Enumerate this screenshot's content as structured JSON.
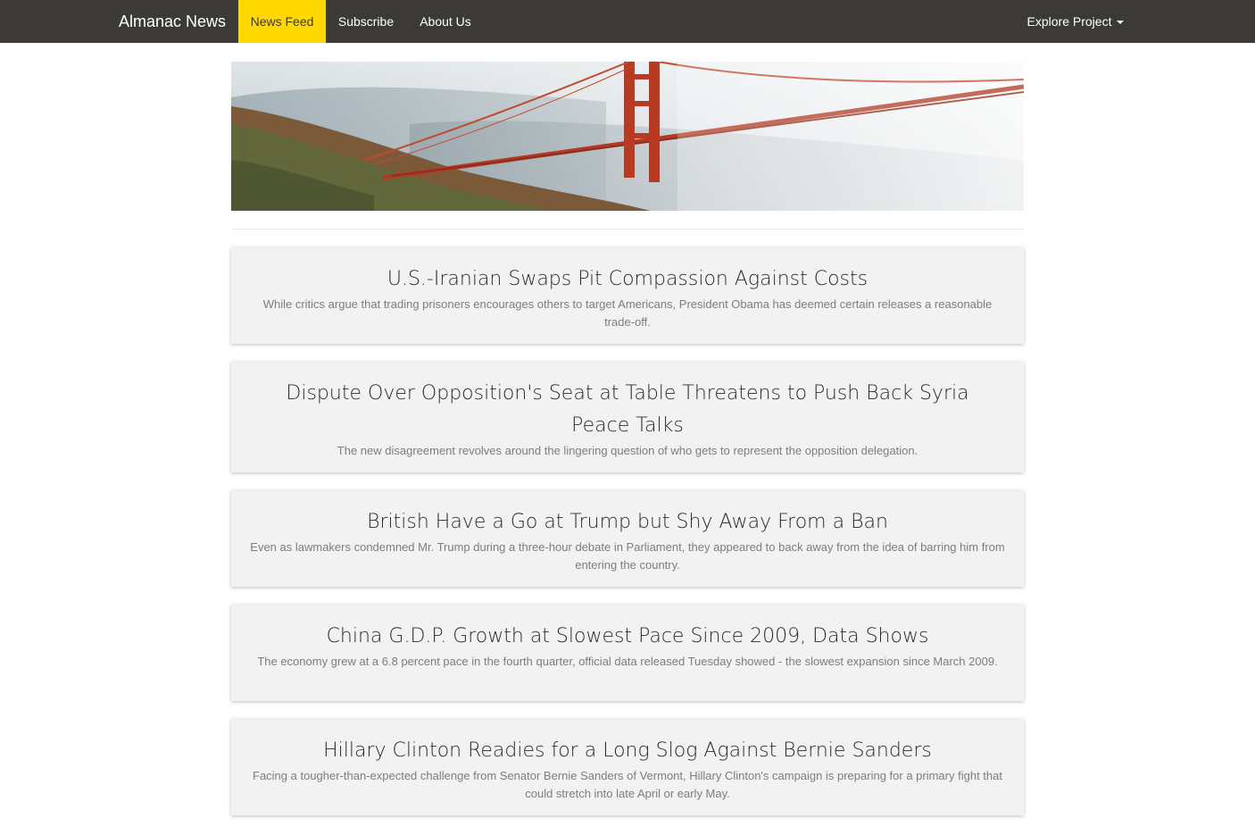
{
  "navbar": {
    "brand": "Almanac News",
    "items": [
      {
        "label": "News Feed"
      },
      {
        "label": "Subscribe"
      },
      {
        "label": "About Us"
      }
    ],
    "dropdown_label": "Explore Project"
  },
  "hero": {
    "icon": "golden-gate-bridge-photo"
  },
  "articles": [
    {
      "title": "U.S.-Iranian Swaps Pit Compassion Against Costs",
      "summary": "While critics argue that trading prisoners encourages others to target Americans, President Obama has deemed certain releases a reasonable trade-off."
    },
    {
      "title": "Dispute Over Opposition's Seat at Table Threatens to Push Back Syria Peace Talks",
      "summary": "The new disagreement revolves around the lingering question of who gets to represent the opposition delegation."
    },
    {
      "title": "British Have a Go at Trump but Shy Away From a Ban",
      "summary": "Even as lawmakers condemned Mr. Trump during a three-hour debate in Parliament, they appeared to back away from the idea of barring him from entering the country."
    },
    {
      "title": "China G.D.P. Growth at Slowest Pace Since 2009, Data Shows",
      "summary": "The economy grew at a 6.8 percent pace in the fourth quarter, official data released Tuesday showed - the slowest expansion since March 2009."
    },
    {
      "title": "Hillary Clinton Readies for a Long Slog Against Bernie Sanders",
      "summary": "Facing a tougher-than-expected challenge from Senator Bernie Sanders of Vermont, Hillary Clinton's campaign is preparing for a primary fight that could stretch into late April or early May."
    }
  ],
  "colors": {
    "navbar_bg": "#3c3a36",
    "active_nav": "#ffd800",
    "card_bg": "#f2f2f2"
  }
}
